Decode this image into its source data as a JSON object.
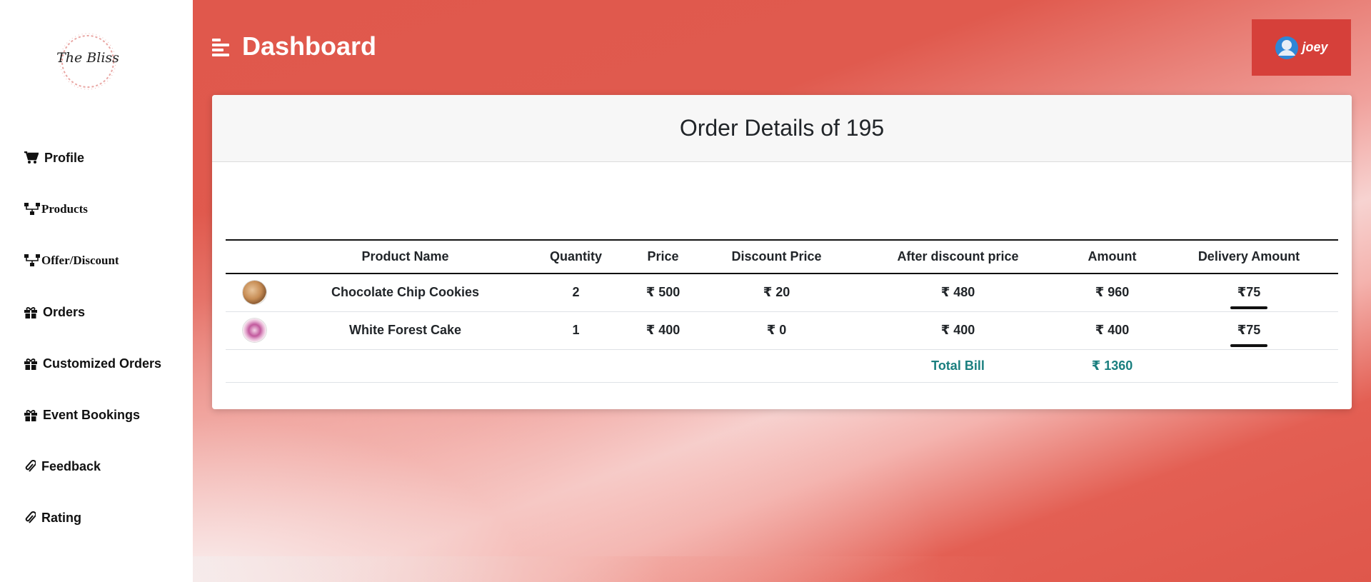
{
  "brand": {
    "logo_text": "The Bliss"
  },
  "sidebar": {
    "items": [
      {
        "label": "Profile",
        "icon": "cart-icon"
      },
      {
        "label": "Products",
        "icon": "sitemap-icon"
      },
      {
        "label": "Offer/Discount",
        "icon": "sitemap-icon"
      },
      {
        "label": "Orders",
        "icon": "gift-icon"
      },
      {
        "label": "Customized Orders",
        "icon": "gift-icon"
      },
      {
        "label": "Event Bookings",
        "icon": "gift-icon"
      },
      {
        "label": "Feedback",
        "icon": "paperclip-icon"
      },
      {
        "label": "Rating",
        "icon": "paperclip-icon"
      }
    ]
  },
  "header": {
    "title": "Dashboard",
    "user": {
      "name": "joey"
    }
  },
  "card": {
    "title": "Order Details of 195"
  },
  "table": {
    "columns": [
      "",
      "Product Name",
      "Quantity",
      "Price",
      "Discount Price",
      "After discount price",
      "Amount",
      "Delivery Amount"
    ],
    "rows": [
      {
        "image": "cookie",
        "product": "Chocolate Chip Cookies",
        "quantity": "2",
        "price": "₹ 500",
        "discount": "₹ 20",
        "after_discount": "₹ 480",
        "amount": "₹ 960",
        "delivery": "₹75"
      },
      {
        "image": "cake",
        "product": "White Forest Cake",
        "quantity": "1",
        "price": "₹ 400",
        "discount": "₹ 0",
        "after_discount": "₹ 400",
        "amount": "₹ 400",
        "delivery": "₹75"
      }
    ],
    "total": {
      "label": "Total Bill",
      "value": "₹ 1360"
    }
  },
  "colors": {
    "accent": "#e0584c",
    "user_button": "#d6403a",
    "total_text": "#1a7f7f"
  }
}
